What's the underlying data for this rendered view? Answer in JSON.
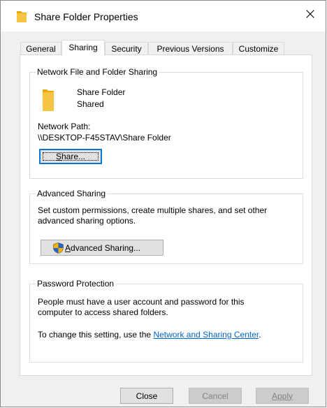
{
  "window": {
    "title": "Share Folder Properties",
    "close_glyph": "✕"
  },
  "tabs": [
    {
      "label": "General"
    },
    {
      "label": "Sharing"
    },
    {
      "label": "Security"
    },
    {
      "label": "Previous Versions"
    },
    {
      "label": "Customize"
    }
  ],
  "network_sharing": {
    "group_label": "Network File and Folder Sharing",
    "folder_name": "Share Folder",
    "status": "Shared",
    "path_label": "Network Path:",
    "path_value": "\\\\DESKTOP-F45STAV\\Share Folder",
    "share_button": {
      "mnemonic": "S",
      "rest": "hare..."
    }
  },
  "advanced_sharing": {
    "group_label": "Advanced Sharing",
    "description_line1": "Set custom permissions, create multiple shares, and set other",
    "description_line2": "advanced sharing options.",
    "button": {
      "mnemonic": "A",
      "rest": "dvanced Sharing..."
    }
  },
  "password_protection": {
    "group_label": "Password Protection",
    "description_line1": "People must have a user account and password for this",
    "description_line2": "computer to access shared folders.",
    "change_text": "To change this setting, use the ",
    "link_text": "Network and Sharing Center",
    "period": "."
  },
  "footer": {
    "close_label": "Close",
    "cancel_label": "Cancel",
    "apply_label": "Apply"
  },
  "colors": {
    "accent": "#0078d7",
    "link": "#0066cc",
    "folder": "#f6c343"
  }
}
